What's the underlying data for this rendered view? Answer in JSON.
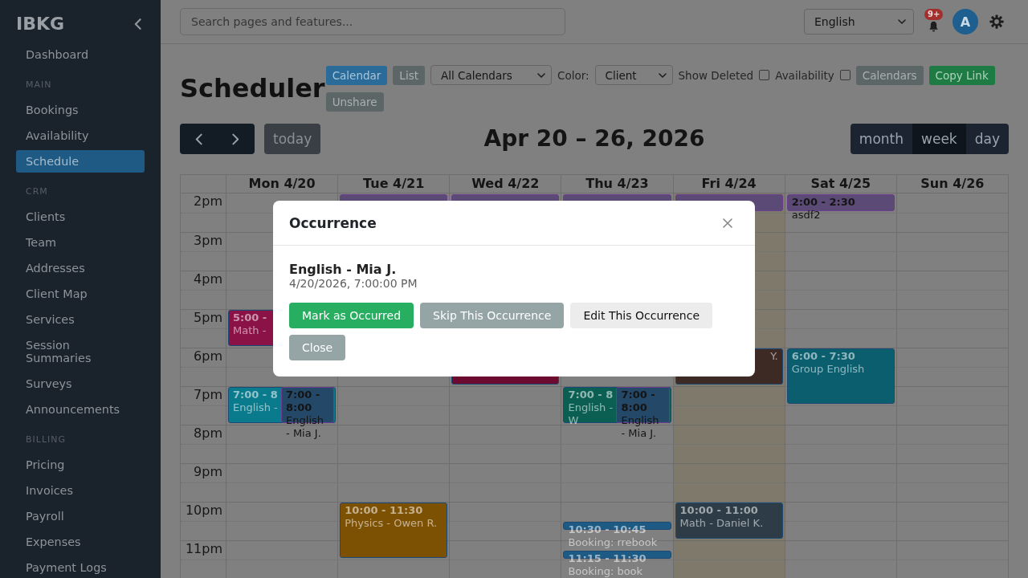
{
  "sidebar": {
    "logo": "IBKG",
    "groups": [
      {
        "items": [
          {
            "label": "Dashboard",
            "selected": false
          }
        ]
      },
      {
        "heading": "MAIN",
        "items": [
          {
            "label": "Bookings",
            "selected": false
          },
          {
            "label": "Availability",
            "selected": false
          },
          {
            "label": "Schedule",
            "selected": true
          }
        ]
      },
      {
        "heading": "CRM",
        "items": [
          {
            "label": "Clients",
            "selected": false
          },
          {
            "label": "Team",
            "selected": false
          },
          {
            "label": "Addresses",
            "selected": false
          },
          {
            "label": "Client Map",
            "selected": false
          },
          {
            "label": "Services",
            "selected": false
          },
          {
            "label": "Session Summaries",
            "selected": false
          },
          {
            "label": "Surveys",
            "selected": false
          },
          {
            "label": "Announcements",
            "selected": false
          }
        ]
      },
      {
        "heading": "BILLING",
        "items": [
          {
            "label": "Pricing",
            "selected": false
          },
          {
            "label": "Invoices",
            "selected": false
          },
          {
            "label": "Payroll",
            "selected": false
          },
          {
            "label": "Expenses",
            "selected": false
          },
          {
            "label": "Payment Logs",
            "selected": false
          }
        ]
      }
    ]
  },
  "topbar": {
    "search": {
      "placeholder": "Search pages and features..."
    },
    "language": {
      "value": "English"
    },
    "notifications": {
      "badge": "9+"
    },
    "avatar": {
      "initial": "A"
    }
  },
  "toolbar": {
    "title": "Scheduler",
    "views": [
      {
        "label": "Calendar",
        "selected": true
      },
      {
        "label": "List",
        "selected": false
      }
    ],
    "calendar_select": {
      "value": "All Calendars"
    },
    "color_select": {
      "label": "Color:",
      "value": "Client"
    },
    "toggles": [
      {
        "label": "Show Deleted",
        "checked": false
      },
      {
        "label": "Availability",
        "checked": false
      }
    ],
    "buttons": [
      {
        "label": "Calendars",
        "kind": "secondary"
      },
      {
        "label": "Copy Link",
        "kind": "success"
      },
      {
        "label": "Unshare",
        "kind": "secondary"
      }
    ]
  },
  "calendar": {
    "today_button": {
      "label": "today",
      "disabled": true
    },
    "range_title": "Apr 20 – 26, 2026",
    "views": [
      {
        "label": "month",
        "selected": false
      },
      {
        "label": "week",
        "selected": true
      },
      {
        "label": "day",
        "selected": false
      }
    ],
    "hours": [
      "2pm",
      "3pm",
      "4pm",
      "5pm",
      "6pm",
      "7pm",
      "8pm",
      "9pm",
      "10pm",
      "11pm"
    ],
    "days": [
      {
        "label": "Mon 4/20",
        "today": false,
        "events": [
          {
            "kind": "single",
            "color": "#8a1247",
            "time": "5:00 -",
            "title": "Math -"
          },
          {
            "kind": "single",
            "color": "#0a7b8c",
            "time": "7:00 - 8",
            "title": "English -"
          },
          {
            "kind": "recurring",
            "color": "#244868",
            "time": "7:00 - 8:00",
            "title": "English - Mia J."
          }
        ]
      },
      {
        "label": "Tue 4/21",
        "today": false,
        "events": [
          {
            "kind": "recurring",
            "color": "#5b4a75"
          },
          {
            "kind": "single",
            "color": "#7d5104",
            "time": "10:00 - 11:30",
            "title": "Physics - Owen R."
          }
        ]
      },
      {
        "label": "Wed 4/22",
        "today": false,
        "events": [
          {
            "kind": "recurring",
            "color": "#5b4a75"
          },
          {
            "kind": "single",
            "color": "#6b0b30"
          }
        ]
      },
      {
        "label": "Thu 4/23",
        "today": false,
        "events": [
          {
            "kind": "recurring",
            "color": "#5b4a75"
          },
          {
            "kind": "single",
            "color": "#0a5f52",
            "time": "7:00 - 8",
            "title": "English - W"
          },
          {
            "kind": "recurring",
            "color": "#244868",
            "time": "7:00 - 8:00",
            "title": "English - Mia J."
          },
          {
            "kind": "single",
            "color": "#1d5a84",
            "time": "10:30 - 10:45",
            "title": "Booking: rrebook"
          },
          {
            "kind": "single",
            "color": "#1d5a84",
            "time": "11:15 - 11:30",
            "title": "Booking: book"
          }
        ]
      },
      {
        "label": "Fri 4/24",
        "today": true,
        "events": [
          {
            "kind": "recurring",
            "color": "#5b4a75"
          },
          {
            "kind": "single",
            "color": "#3e2a25",
            "title": "Y.",
            "start_hidden": true
          },
          {
            "kind": "single",
            "color": "#2d3c47",
            "time": "10:00 - 11:00",
            "title": "Math - Daniel K."
          }
        ]
      },
      {
        "label": "Sat 4/25",
        "today": false,
        "events": [
          {
            "kind": "recurring",
            "color": "#5b4a75",
            "time": "2:00 - 2:30",
            "title": "asdf2"
          },
          {
            "kind": "single",
            "color": "#0a5e6e",
            "time": "6:00 - 7:30",
            "title": "Group English"
          }
        ]
      },
      {
        "label": "Sun 4/26",
        "today": false
      }
    ]
  },
  "modal": {
    "title": "Occurrence",
    "event_title": "English - Mia J.",
    "datetime": "4/20/2026, 7:00:00 PM",
    "buttons": [
      {
        "label": "Mark as Occurred",
        "kind": "success"
      },
      {
        "label": "Skip This Occurrence",
        "kind": "secondary"
      },
      {
        "label": "Edit This Occurrence",
        "kind": "light"
      },
      {
        "label": "Close",
        "kind": "secondary"
      }
    ]
  }
}
